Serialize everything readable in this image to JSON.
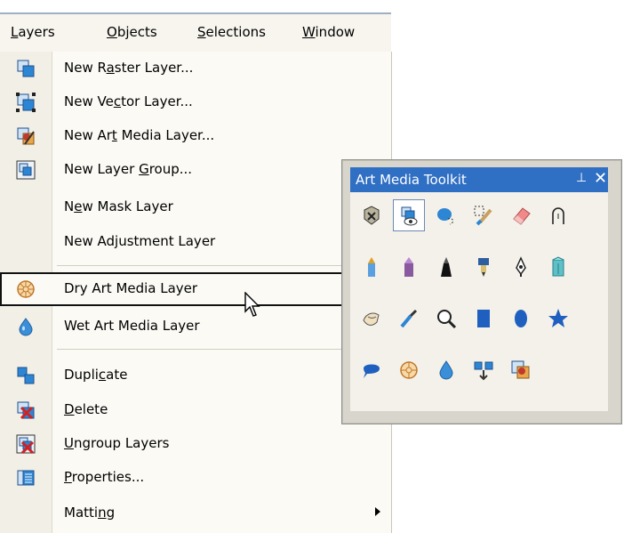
{
  "menubar": {
    "items": [
      {
        "pre": "",
        "ul": "L",
        "post": "ayers"
      },
      {
        "pre": "",
        "ul": "O",
        "post": "bjects"
      },
      {
        "pre": "",
        "ul": "S",
        "post": "elections"
      },
      {
        "pre": "",
        "ul": "W",
        "post": "indow"
      }
    ]
  },
  "menu": {
    "items": [
      {
        "pre": "New R",
        "ul": "a",
        "post": "ster Layer...",
        "icon": "raster-layer-icon"
      },
      {
        "pre": "New Ve",
        "ul": "c",
        "post": "tor Layer...",
        "icon": "vector-layer-icon"
      },
      {
        "pre": "New Ar",
        "ul": "t",
        "post": " Media Layer...",
        "icon": "art-media-layer-icon"
      },
      {
        "pre": "New Layer ",
        "ul": "G",
        "post": "roup...",
        "icon": "layer-group-icon"
      },
      {
        "pre": "N",
        "ul": "e",
        "post": "w Mask Layer",
        "icon": ""
      },
      {
        "pre": "New Ad",
        "ul": "j",
        "post": "ustment Layer",
        "icon": ""
      },
      {
        "pre": "Dry Art Media Layer",
        "ul": "",
        "post": "",
        "icon": "dry-art-media-icon"
      },
      {
        "pre": "Wet Art Media Layer",
        "ul": "",
        "post": "",
        "icon": "wet-art-media-icon"
      },
      {
        "pre": "Dupli",
        "ul": "c",
        "post": "ate",
        "icon": "duplicate-icon"
      },
      {
        "pre": "",
        "ul": "D",
        "post": "elete",
        "icon": "delete-icon"
      },
      {
        "pre": "",
        "ul": "U",
        "post": "ngroup Layers",
        "icon": "ungroup-layers-icon"
      },
      {
        "pre": "",
        "ul": "P",
        "post": "roperties...",
        "icon": "properties-icon"
      },
      {
        "pre": "Matti",
        "ul": "n",
        "post": "g",
        "icon": ""
      }
    ]
  },
  "toolkit": {
    "title": "Art Media Toolkit",
    "pin": "⊥",
    "close": "✕"
  }
}
